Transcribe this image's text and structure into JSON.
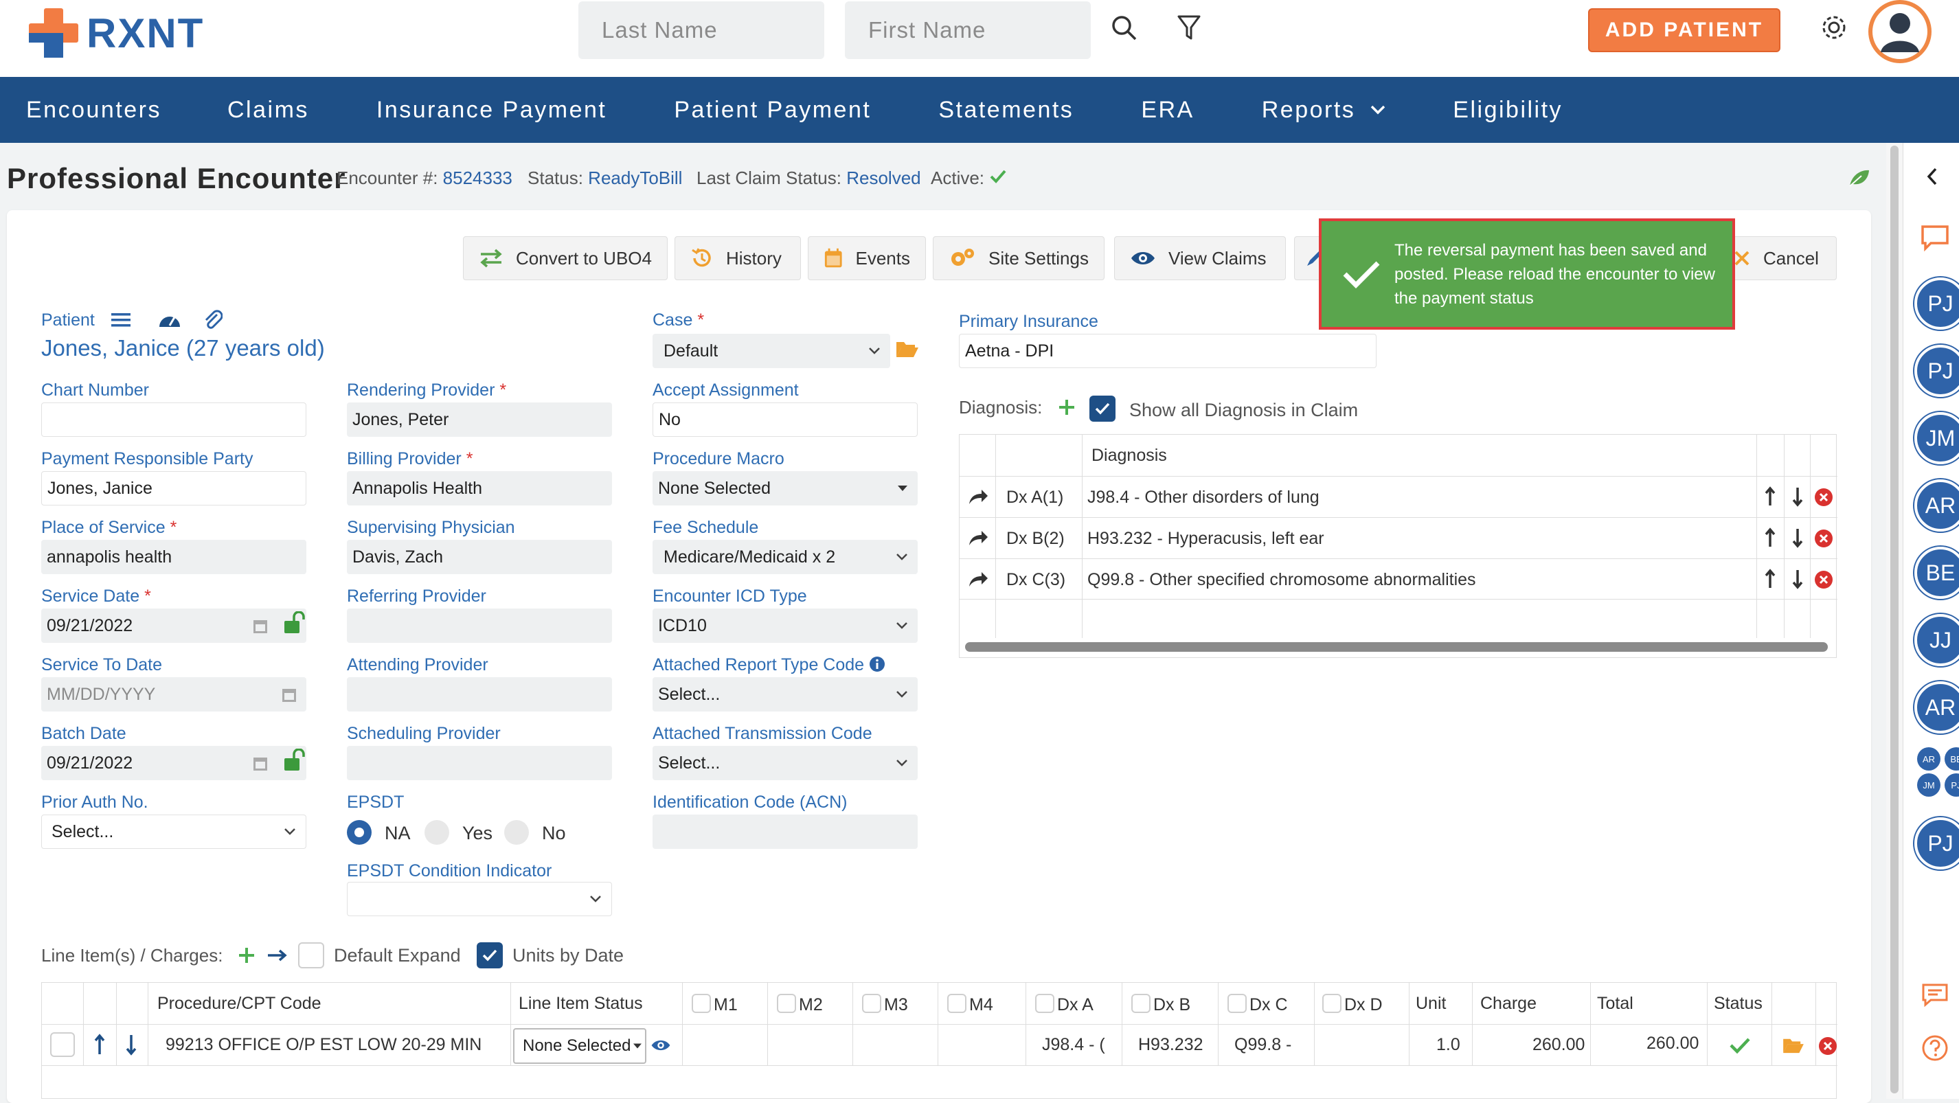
{
  "app": {
    "brand": "RXNT",
    "brand_color": "#2b62a7",
    "accent": "#f27c43"
  },
  "search": {
    "last_name_placeholder": "Last Name",
    "first_name_placeholder": "First Name"
  },
  "topbar": {
    "add_patient": "ADD PATIENT"
  },
  "nav": {
    "items": [
      "Encounters",
      "Claims",
      "Insurance Payment",
      "Patient Payment",
      "Statements",
      "ERA",
      "Reports",
      "Eligibility"
    ]
  },
  "header": {
    "title": "Professional Encounter",
    "encounter_label": "Encounter #:",
    "encounter_value": "8524333",
    "status_label": "Status:",
    "status_value": "ReadyToBill",
    "last_claim_label": "Last Claim Status:",
    "last_claim_value": "Resolved",
    "active_label": "Active:"
  },
  "toolbar": {
    "convert": "Convert to UBO4",
    "history": "History",
    "events": "Events",
    "site_settings": "Site Settings",
    "view_claims": "View Claims",
    "cancel": "Cancel"
  },
  "toast": {
    "message": "The reversal payment has been saved and posted. Please reload the encounter to view the payment status"
  },
  "patient": {
    "label": "Patient",
    "name": "Jones, Janice (27 years old)"
  },
  "form": {
    "chart_number": {
      "label": "Chart Number",
      "value": ""
    },
    "payment_party": {
      "label": "Payment Responsible Party",
      "value": "Jones, Janice"
    },
    "place_of_service": {
      "label": "Place of Service",
      "value": "annapolis health"
    },
    "service_date": {
      "label": "Service Date",
      "value": "09/21/2022"
    },
    "service_to_date": {
      "label": "Service To Date",
      "placeholder": "MM/DD/YYYY"
    },
    "batch_date": {
      "label": "Batch Date",
      "value": "09/21/2022"
    },
    "prior_auth": {
      "label": "Prior Auth No.",
      "value": "Select..."
    },
    "rendering_provider": {
      "label": "Rendering Provider",
      "value": "Jones, Peter"
    },
    "billing_provider": {
      "label": "Billing Provider",
      "value": "Annapolis Health"
    },
    "supervising_physician": {
      "label": "Supervising Physician",
      "value": "Davis, Zach"
    },
    "referring_provider": {
      "label": "Referring Provider",
      "value": ""
    },
    "attending_provider": {
      "label": "Attending Provider",
      "value": ""
    },
    "scheduling_provider": {
      "label": "Scheduling Provider",
      "value": ""
    },
    "epsdt": {
      "label": "EPSDT",
      "options": [
        "NA",
        "Yes",
        "No"
      ],
      "selected": "NA"
    },
    "epsdt_condition": {
      "label": "EPSDT Condition Indicator",
      "value": ""
    },
    "case": {
      "label": "Case",
      "value": "Default"
    },
    "accept_assignment": {
      "label": "Accept Assignment",
      "value": "No"
    },
    "procedure_macro": {
      "label": "Procedure Macro",
      "value": "None Selected"
    },
    "fee_schedule": {
      "label": "Fee Schedule",
      "value": "Medicare/Medicaid x 2"
    },
    "icd_type": {
      "label": "Encounter ICD Type",
      "value": "ICD10"
    },
    "report_type_code": {
      "label": "Attached Report Type Code",
      "value": "Select..."
    },
    "transmission_code": {
      "label": "Attached Transmission Code",
      "value": "Select..."
    },
    "acn": {
      "label": "Identification Code (ACN)",
      "value": ""
    },
    "primary_insurance": {
      "label": "Primary Insurance",
      "value": "Aetna - DPI"
    }
  },
  "diagnosis": {
    "label": "Diagnosis:",
    "show_all": "Show all Diagnosis in Claim",
    "column": "Diagnosis",
    "rows": [
      {
        "pointer": "Dx A(1)",
        "text": "J98.4 - Other disorders of lung"
      },
      {
        "pointer": "Dx B(2)",
        "text": "H93.232 - Hyperacusis, left ear"
      },
      {
        "pointer": "Dx C(3)",
        "text": "Q99.8 - Other specified chromosome abnormalities"
      }
    ]
  },
  "line_items": {
    "label": "Line Item(s) / Charges:",
    "default_expand": "Default Expand",
    "units_by_date": "Units by Date",
    "columns": {
      "cpt": "Procedure/CPT Code",
      "status": "Line Item Status",
      "m1": "M1",
      "m2": "M2",
      "m3": "M3",
      "m4": "M4",
      "dxa": "Dx A",
      "dxb": "Dx B",
      "dxc": "Dx C",
      "dxd": "Dx D",
      "unit": "Unit",
      "charge": "Charge",
      "total": "Total",
      "row_status": "Status"
    },
    "row": {
      "cpt": "99213 OFFICE O/P EST LOW 20-29 MIN",
      "status": "None Selected",
      "dxa": "J98.4 - (",
      "dxb": "H93.232",
      "dxc": "Q99.8 -",
      "unit": "1.0",
      "charge": "260.00",
      "total": "260.00"
    }
  },
  "rail": {
    "avatars": [
      "PJ",
      "PJ",
      "JM",
      "AR",
      "BE",
      "JJ",
      "AR"
    ],
    "group": [
      "AR",
      "BE",
      "JM",
      "PJ"
    ],
    "last": "PJ"
  }
}
